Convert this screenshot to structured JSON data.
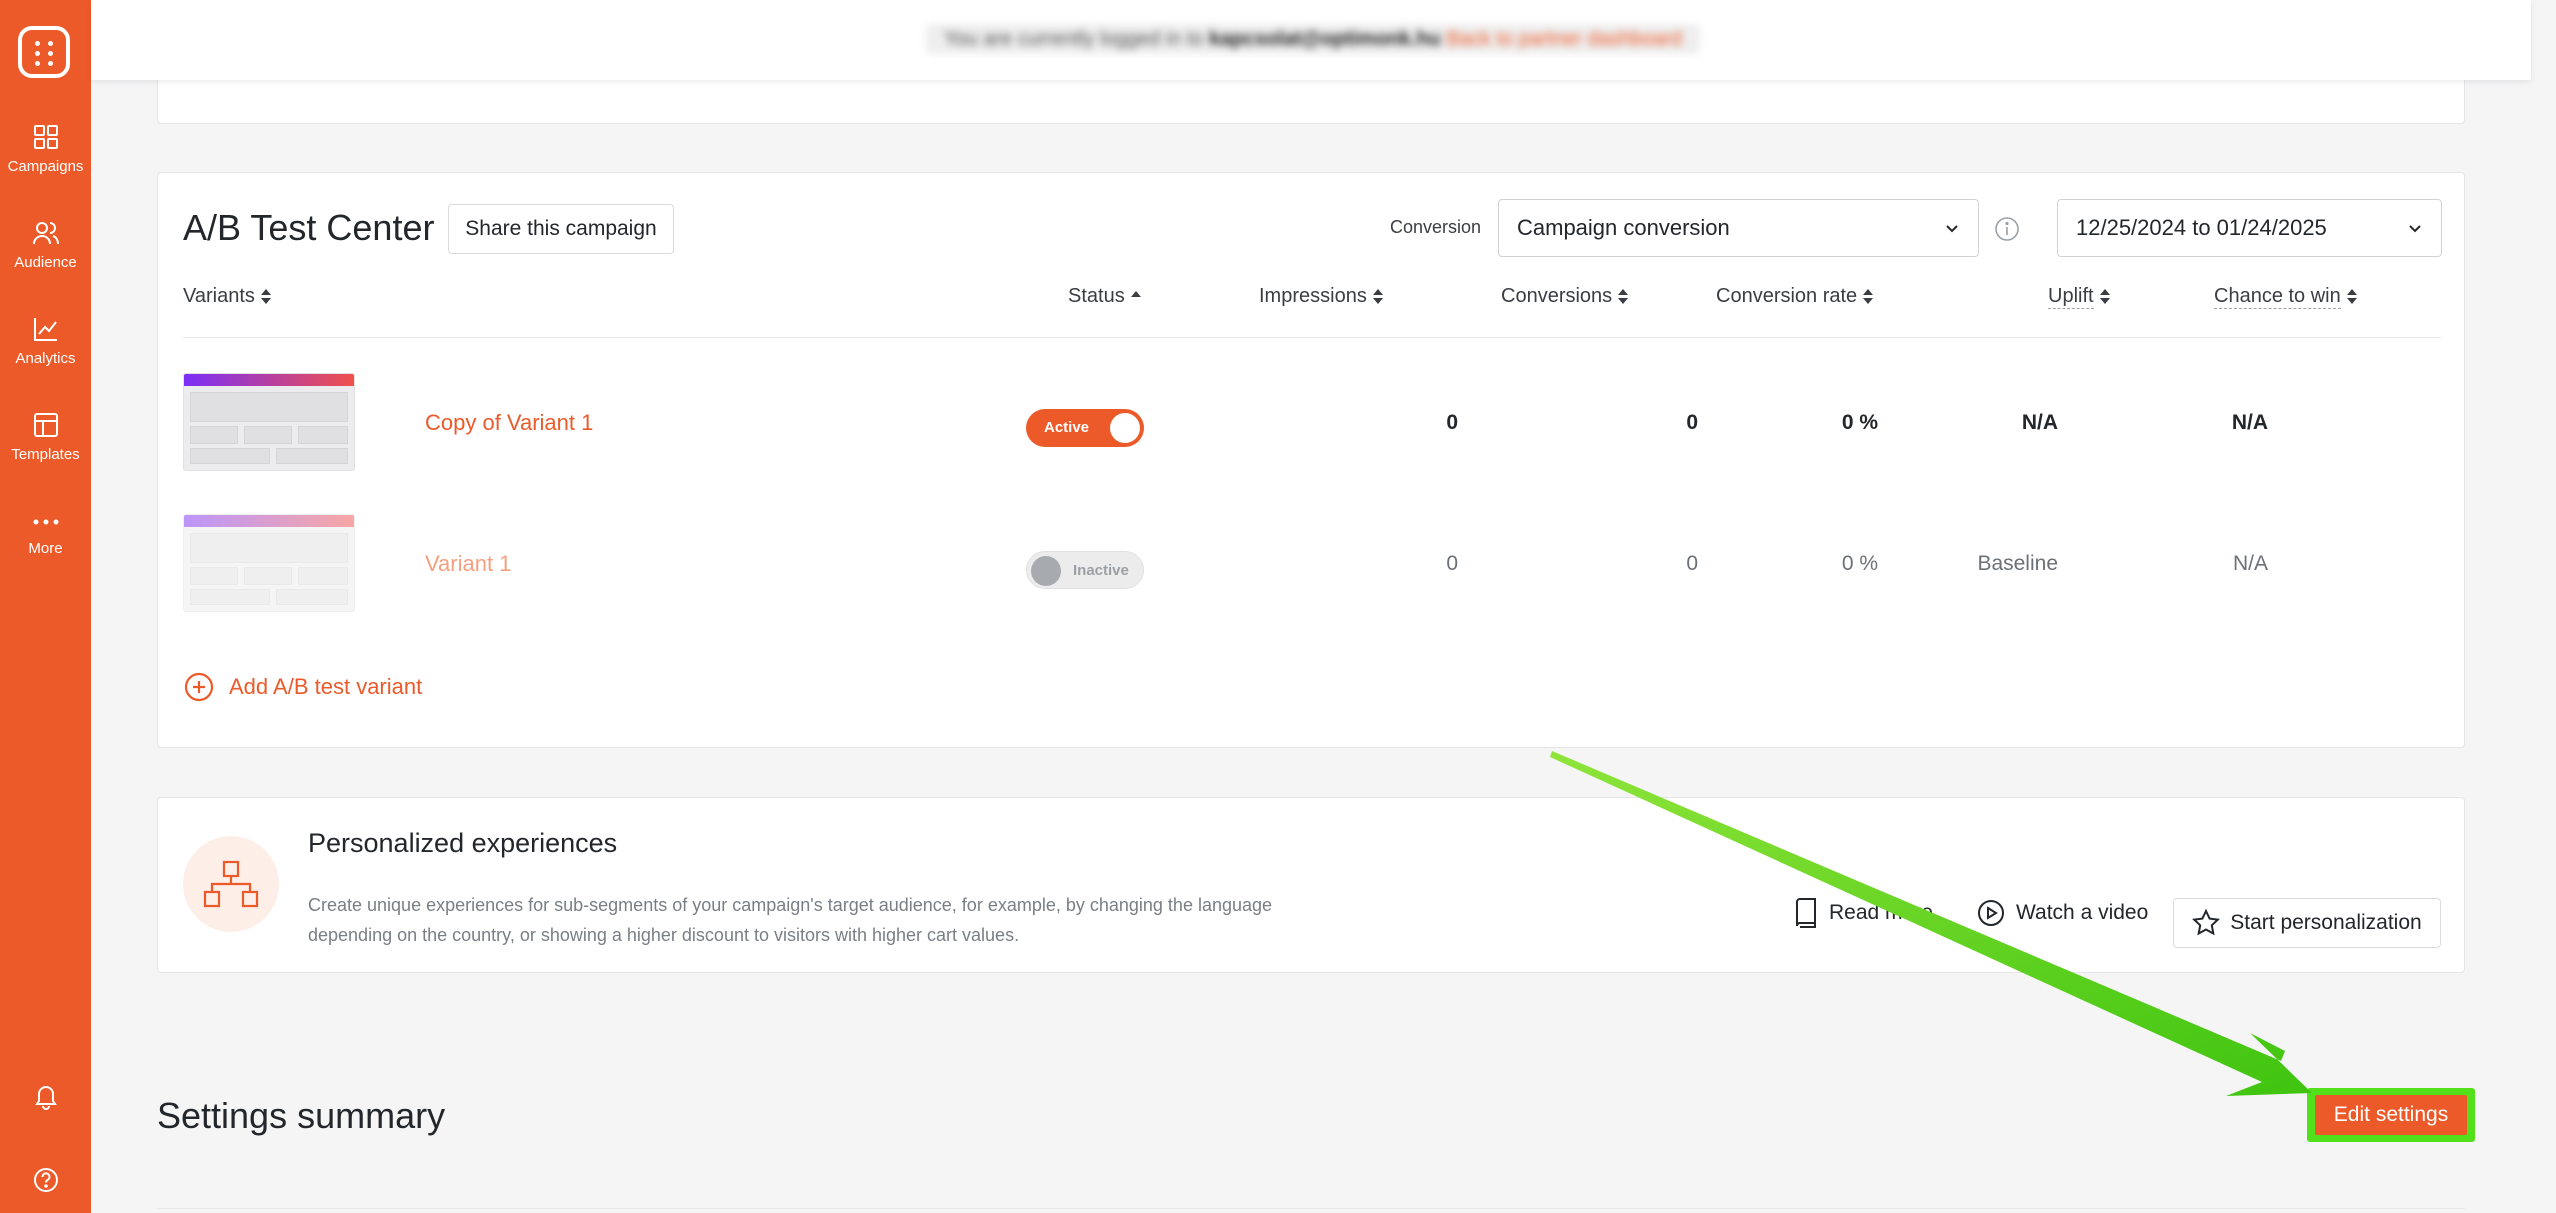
{
  "notice": {
    "prefix": "You are currently logged in to ",
    "email": "kapcsolat@optimonk.hu",
    "link": "Back to partner dashboard"
  },
  "sidebar": {
    "items": [
      {
        "label": "Campaigns",
        "icon": "grid-icon"
      },
      {
        "label": "Audience",
        "icon": "users-icon"
      },
      {
        "label": "Analytics",
        "icon": "line-chart-icon"
      },
      {
        "label": "Templates",
        "icon": "layout-icon"
      },
      {
        "label": "More",
        "icon": "more-dots-icon"
      }
    ]
  },
  "ab": {
    "title": "A/B Test Center",
    "share_label": "Share this campaign",
    "conversion_label": "Conversion",
    "conversion_value": "Campaign conversion",
    "date_range": "12/25/2024 to 01/24/2025",
    "columns": {
      "variants": "Variants",
      "status": "Status",
      "impressions": "Impressions",
      "conversions": "Conversions",
      "conversion_rate": "Conversion rate",
      "uplift": "Uplift",
      "chance": "Chance to win"
    },
    "rows": [
      {
        "name": "Copy of Variant 1",
        "status": "Active",
        "impressions": "0",
        "conversions": "0",
        "rate": "0 %",
        "uplift": "N/A",
        "chance": "N/A"
      },
      {
        "name": "Variant 1",
        "status": "Inactive",
        "impressions": "0",
        "conversions": "0",
        "rate": "0 %",
        "uplift": "Baseline",
        "chance": "N/A"
      }
    ],
    "add_variant": "Add A/B test variant"
  },
  "personalized": {
    "title": "Personalized experiences",
    "description": "Create unique experiences for sub-segments of your campaign's target audience, for example, by changing the language depending on the country, or showing a higher discount to visitors with higher cart values.",
    "read_more": "Read more",
    "watch_video": "Watch a video",
    "start": "Start personalization"
  },
  "settings": {
    "title": "Settings summary",
    "edit_label": "Edit settings"
  },
  "colors": {
    "brand": "#ed5a29",
    "highlight": "#52e01a"
  }
}
